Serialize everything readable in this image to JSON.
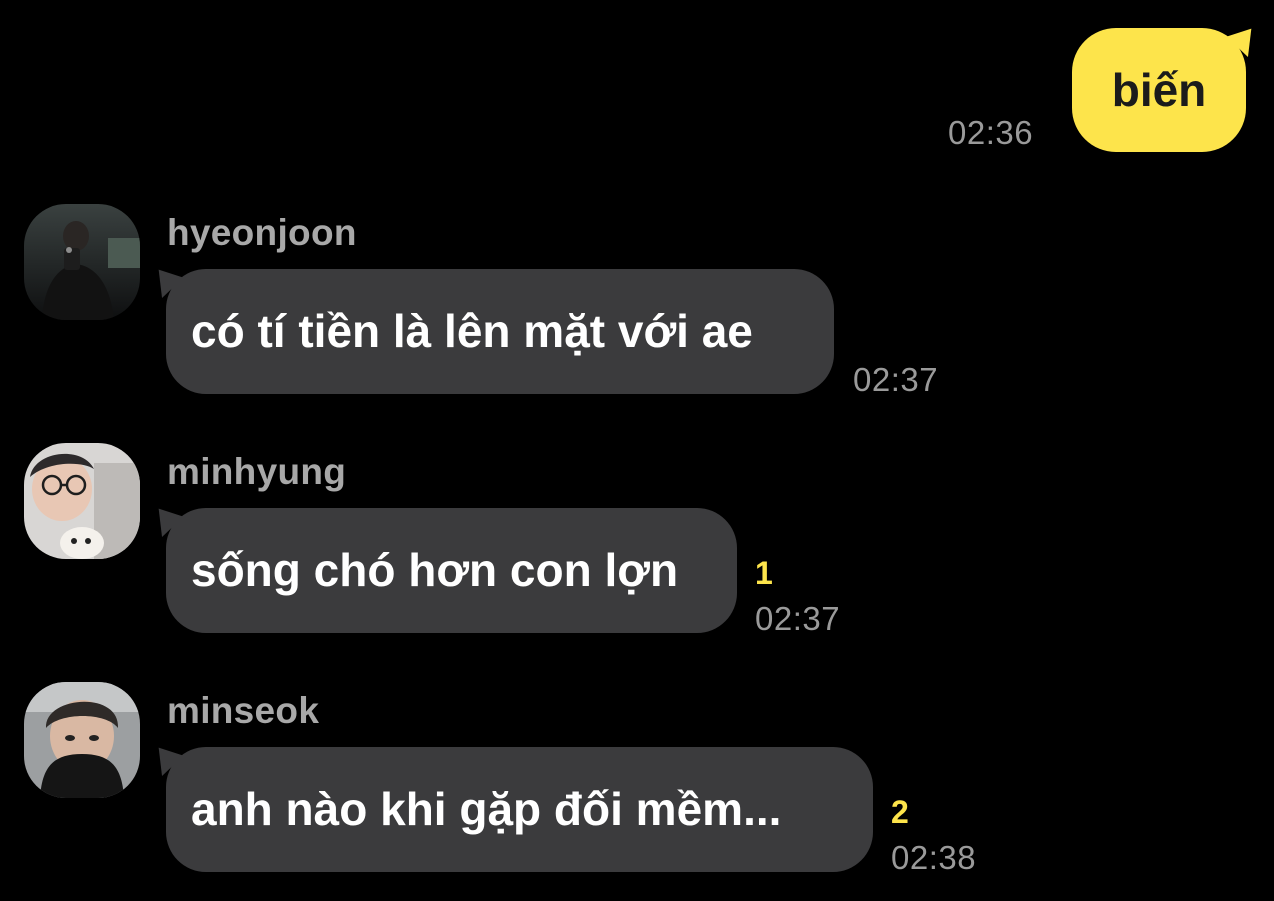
{
  "colors": {
    "background": "#000000",
    "outgoing_bubble": "#fde44b",
    "incoming_bubble": "#3b3b3d",
    "unread_count": "#fde44b"
  },
  "messages": {
    "outgoing": {
      "text": "biến",
      "time": "02:36"
    },
    "incoming": [
      {
        "sender": "hyeonjoon",
        "avatar_icon": "avatar-photo",
        "text": "có tí tiền là lên mặt với ae",
        "unread": "",
        "time": "02:37"
      },
      {
        "sender": "minhyung",
        "avatar_icon": "avatar-photo",
        "text": "sống chó hơn con lợn",
        "unread": "1",
        "time": "02:37"
      },
      {
        "sender": "minseok",
        "avatar_icon": "avatar-photo",
        "text": "anh nào khi gặp đối mềm...",
        "unread": "2",
        "time": "02:38"
      }
    ]
  }
}
